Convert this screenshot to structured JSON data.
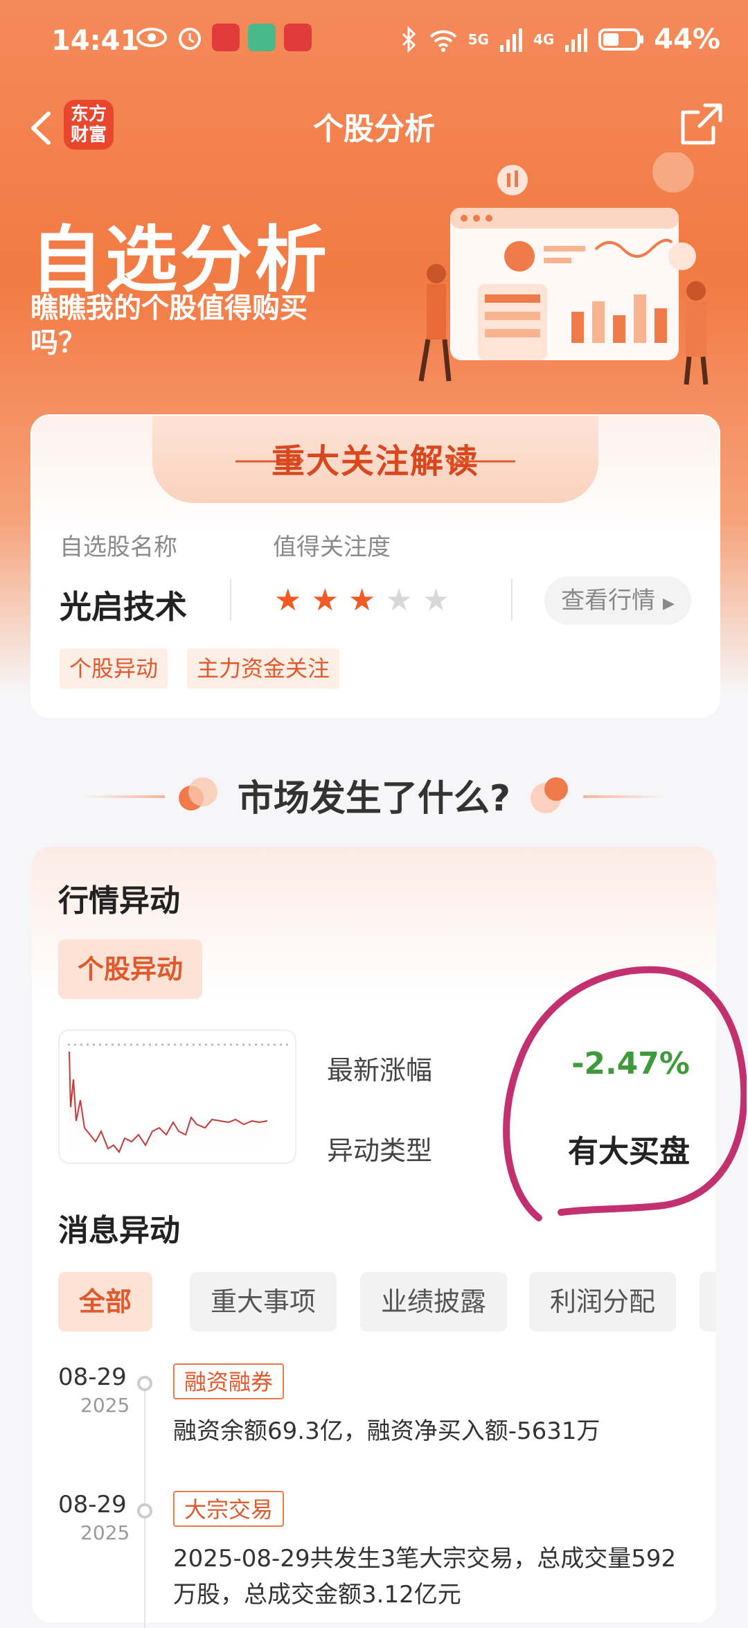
{
  "status_bar": {
    "time": "14:41",
    "network_5g": "5G",
    "network_4g": "4G",
    "battery": "44%"
  },
  "nav": {
    "logo_line1": "东方",
    "logo_line2": "财富",
    "title": "个股分析"
  },
  "banner": {
    "title": "自选分析",
    "subtitle": "瞧瞧我的个股值得购买吗？"
  },
  "focus_card": {
    "title": "重大关注解读",
    "label_name": "自选股名称",
    "label_attention": "值得关注度",
    "stock_name": "光启技术",
    "rating": 3,
    "rating_max": 5,
    "view_button": "查看行情",
    "tags": [
      "个股异动",
      "主力资金关注"
    ]
  },
  "section_title": "市场发生了什么?",
  "market_card": {
    "heading": "行情异动",
    "pill": "个股异动",
    "latest_change_label": "最新涨幅",
    "latest_change_value": "-2.47%",
    "anomaly_type_label": "异动类型",
    "anomaly_type_value": "有大买盘",
    "news_heading": "消息异动",
    "filters": [
      "全部",
      "重大事项",
      "业绩披露",
      "利润分配"
    ],
    "timeline": [
      {
        "date": "08-29",
        "year": "2025",
        "tag": "融资融券",
        "text": "融资余额69.3亿，融资净买入额-5631万"
      },
      {
        "date": "08-29",
        "year": "2025",
        "tag": "大宗交易",
        "text": "2025-08-29共发生3笔大宗交易，总成交量592万股，总成交金额3.12亿元"
      }
    ]
  },
  "colors": {
    "accent": "#e0592d",
    "down_green": "#3f9a3c",
    "star_on": "#f05a24",
    "star_off": "#d8d8d8",
    "annotation": "#c2306f"
  }
}
